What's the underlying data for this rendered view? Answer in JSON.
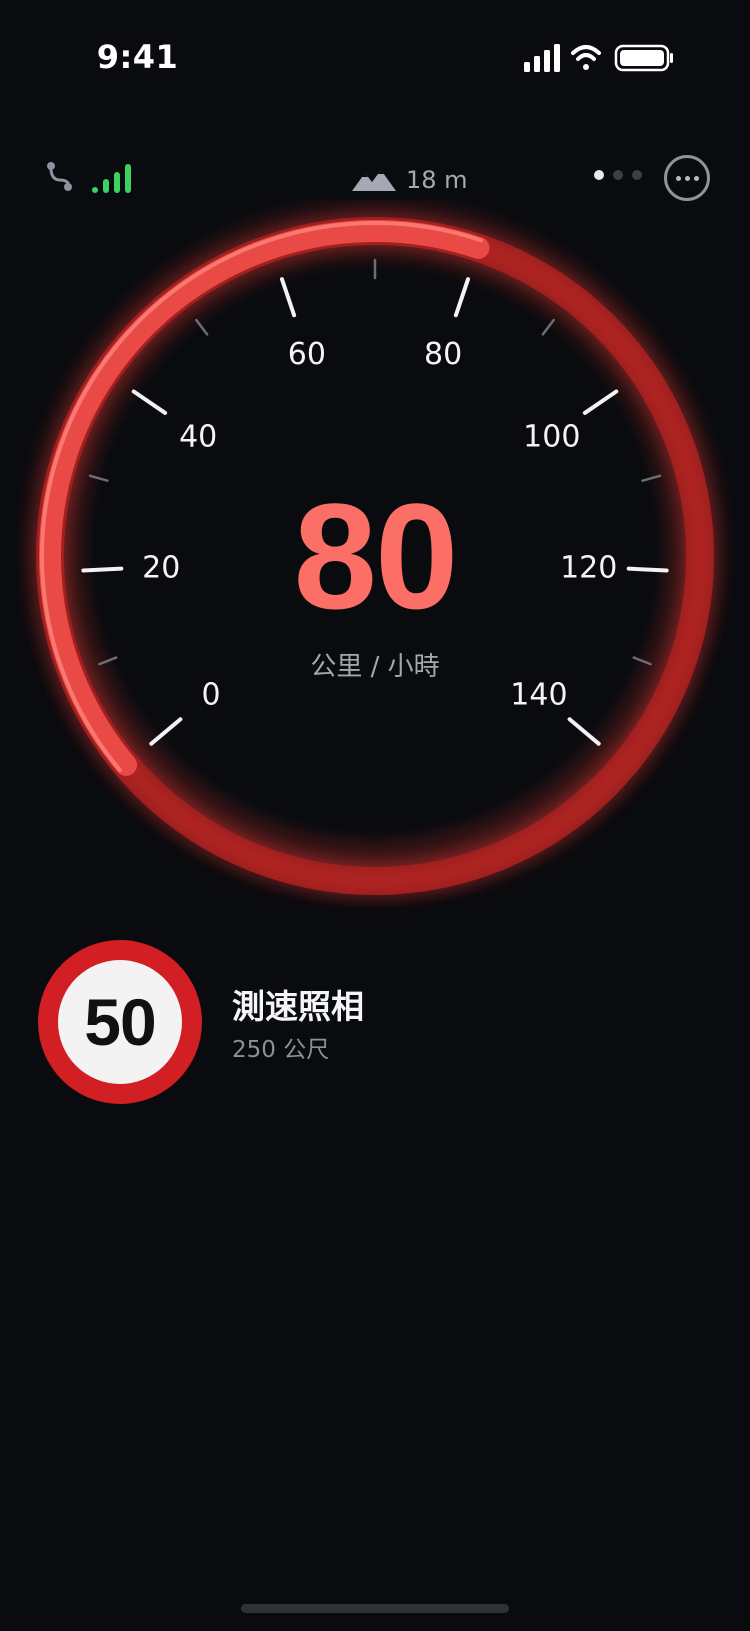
{
  "status_bar": {
    "time": "9:41"
  },
  "topbar": {
    "route_icon": "route-icon",
    "gps_signal_icon": "gps-signal-icon",
    "gps_color": "#3bd25f",
    "elevation_icon": "mountain-icon",
    "elevation": "18 m",
    "page_count": 3,
    "active_page": 1,
    "more_icon": "more-icon"
  },
  "gauge": {
    "ticks": [
      "0",
      "20",
      "40",
      "60",
      "80",
      "100",
      "120",
      "140"
    ],
    "min": 0,
    "max": 140,
    "current_speed": 80,
    "speed_text": "80",
    "unit": "公里 / 小時",
    "accent": "#e23a36",
    "speed_color": "#fb6f66"
  },
  "alert": {
    "limit": "50",
    "title": "測速照相",
    "distance": "250 公尺",
    "sign_color": "#d21f24"
  }
}
